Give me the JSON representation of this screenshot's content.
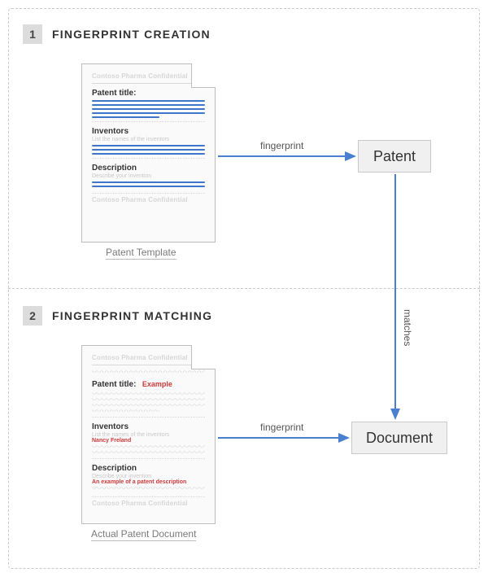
{
  "section1": {
    "badge": "1",
    "title": "FINGERPRINT CREATION",
    "doc_caption": "Patent Template",
    "edge_label": "fingerprint",
    "node_label": "Patent",
    "doc": {
      "header": "Contoso Pharma Confidential",
      "footer": "Contoso Pharma Confidential",
      "patent_title_label": "Patent title:",
      "inventors_label": "Inventors",
      "inventors_sub": "List the names of the inventors",
      "description_label": "Description",
      "description_sub": "Describe your invention"
    }
  },
  "vertical_edge_label": "matches",
  "section2": {
    "badge": "2",
    "title": "FINGERPRINT MATCHING",
    "doc_caption": "Actual Patent Document",
    "edge_label": "fingerprint",
    "node_label": "Document",
    "doc": {
      "header": "Contoso Pharma Confidential",
      "footer": "Contoso Pharma Confidential",
      "patent_title_label": "Patent title:",
      "patent_title_value": "Example",
      "inventors_label": "Inventors",
      "inventors_sub": "List the names of the inventors",
      "inventors_value": "Nancy Freland",
      "description_label": "Description",
      "description_sub": "Describe your invention",
      "description_value": "An example of a patent description"
    }
  }
}
